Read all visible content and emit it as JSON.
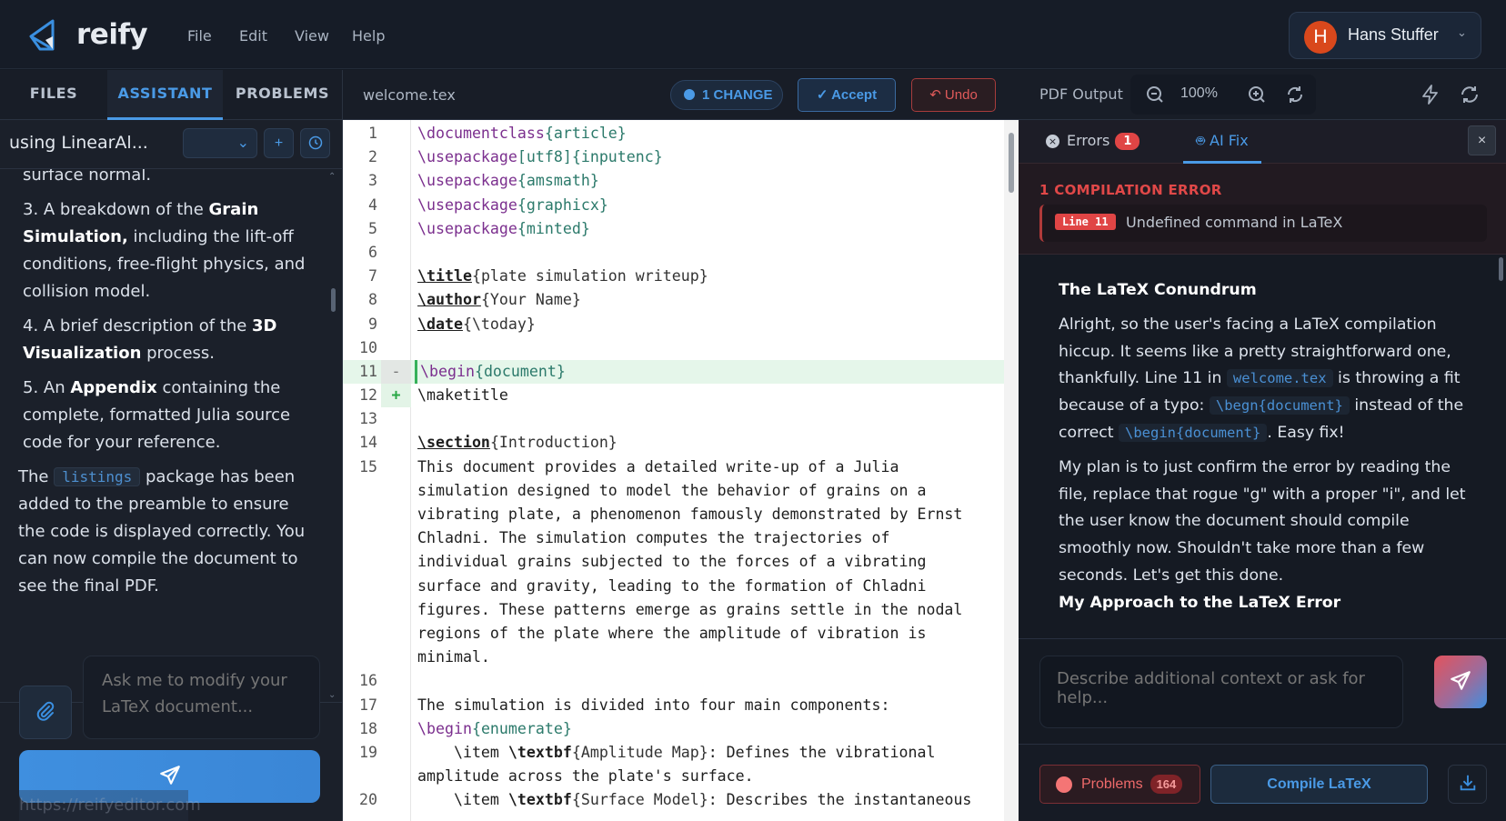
{
  "header": {
    "brand": "reify",
    "menu": [
      "File",
      "Edit",
      "View",
      "Help"
    ],
    "user": {
      "initial": "H",
      "name": "Hans Stuffer"
    }
  },
  "left": {
    "tabs": [
      "FILES",
      "ASSISTANT",
      "PROBLEMS"
    ],
    "active_tab": "ASSISTANT",
    "session_name": "using LinearAl...",
    "new_label": "+",
    "content": {
      "p0": "surface normal.",
      "item3": {
        "a": "3. A breakdown of the ",
        "b": "Grain Simulation,",
        "c": " including the lift-off conditions, free-flight physics, and collision model."
      },
      "item4": {
        "a": "4. A brief description of the ",
        "b": "3D Visualization",
        "c": " process."
      },
      "item5": {
        "a": "5. An ",
        "b": "Appendix",
        "c": " containing the complete, formatted Julia source code for your reference."
      },
      "para": {
        "a": "The ",
        "code": "listings",
        "c": " package has been added to the preamble to ensure the code is displayed correctly. You can now compile the document to see the final PDF."
      }
    },
    "input_placeholder": "Ask me to modify your LaTeX document...",
    "url_overlay": "https://reifyeditor.com"
  },
  "editor": {
    "filename": "welcome.tex",
    "changes": "1 CHANGE",
    "accept": "✓ Accept",
    "undo": "↶ Undo",
    "lines": [
      {
        "n": "1",
        "rows": [
          [
            [
              "cmd",
              "\\documentclass"
            ],
            [
              "arg",
              "{article}"
            ]
          ]
        ]
      },
      {
        "n": "2",
        "rows": [
          [
            [
              "cmd",
              "\\usepackage"
            ],
            [
              "arg",
              "[utf8]{inputenc}"
            ]
          ]
        ]
      },
      {
        "n": "3",
        "rows": [
          [
            [
              "cmd",
              "\\usepackage"
            ],
            [
              "arg",
              "{amsmath}"
            ]
          ]
        ]
      },
      {
        "n": "4",
        "rows": [
          [
            [
              "cmd",
              "\\usepackage"
            ],
            [
              "arg",
              "{graphicx}"
            ]
          ]
        ]
      },
      {
        "n": "5",
        "rows": [
          [
            [
              "cmd",
              "\\usepackage"
            ],
            [
              "arg",
              "{minted}"
            ]
          ]
        ]
      },
      {
        "n": "6",
        "rows": [
          []
        ]
      },
      {
        "n": "7",
        "rows": [
          [
            [
              "kw",
              "\\title"
            ],
            [
              "br",
              "{plate simulation writeup}"
            ]
          ]
        ]
      },
      {
        "n": "8",
        "rows": [
          [
            [
              "kw",
              "\\author"
            ],
            [
              "br",
              "{Your Name}"
            ]
          ]
        ]
      },
      {
        "n": "9",
        "rows": [
          [
            [
              "kw",
              "\\date"
            ],
            [
              "br",
              "{\\today}"
            ]
          ]
        ]
      },
      {
        "n": "10",
        "rows": [
          []
        ]
      },
      {
        "n": "11",
        "diff": "del",
        "mark": "-",
        "rows": [
          [
            [
              "cmd",
              "\\begin"
            ],
            [
              "arg",
              "{document}"
            ]
          ]
        ]
      },
      {
        "n": "12",
        "diff": "add",
        "mark": "+",
        "rows": [
          [
            [
              "plain",
              "\\maketitle"
            ]
          ]
        ]
      },
      {
        "n": "13",
        "rows": [
          []
        ]
      },
      {
        "n": "14",
        "rows": [
          [
            [
              "kw",
              "\\section"
            ],
            [
              "br",
              "{Introduction}"
            ]
          ]
        ]
      },
      {
        "n": "15",
        "rows": [
          [
            [
              "plain",
              "This document provides a detailed write-up of a Julia"
            ]
          ],
          [
            [
              "plain",
              "simulation designed to model the behavior of grains on a"
            ]
          ],
          [
            [
              "plain",
              "vibrating plate, a phenomenon famously demonstrated by Ernst"
            ]
          ],
          [
            [
              "plain",
              "Chladni. The simulation computes the trajectories of"
            ]
          ],
          [
            [
              "plain",
              "individual grains subjected to the forces of a vibrating"
            ]
          ],
          [
            [
              "plain",
              "surface and gravity, leading to the formation of Chladni"
            ]
          ],
          [
            [
              "plain",
              "figures. These patterns emerge as grains settle in the nodal"
            ]
          ],
          [
            [
              "plain",
              "regions of the plate where the amplitude of vibration is"
            ]
          ],
          [
            [
              "plain",
              "minimal."
            ]
          ]
        ]
      },
      {
        "n": "16",
        "rows": [
          []
        ]
      },
      {
        "n": "17",
        "rows": [
          [
            [
              "plain",
              "The simulation is divided into four main components:"
            ]
          ]
        ]
      },
      {
        "n": "18",
        "rows": [
          [
            [
              "cmd",
              "\\begin"
            ],
            [
              "arg",
              "{enumerate}"
            ]
          ]
        ]
      },
      {
        "n": "19",
        "rows": [
          [
            [
              "plain",
              "    \\item "
            ],
            [
              "b",
              "\\textbf"
            ],
            [
              "br",
              "{Amplitude Map}"
            ],
            [
              "plain",
              ": Defines the vibrational"
            ]
          ],
          [
            [
              "plain",
              "amplitude across the plate's surface."
            ]
          ]
        ]
      },
      {
        "n": "20",
        "rows": [
          [
            [
              "plain",
              "    \\item "
            ],
            [
              "b",
              "\\textbf"
            ],
            [
              "br",
              "{Surface Model}"
            ],
            [
              "plain",
              ": Describes the instantaneous"
            ]
          ]
        ]
      }
    ]
  },
  "right": {
    "title": "PDF Output",
    "zoom": "100%",
    "tabs": {
      "errors": "Errors",
      "errors_count": "1",
      "aifix": "AI Fix"
    },
    "close": "×",
    "error_title": "1 COMPILATION ERROR",
    "error": {
      "line": "Line 11",
      "message": "Undefined command in LaTeX"
    },
    "ai": {
      "heading": "The LaTeX Conundrum",
      "p1a": "Alright, so the user's facing a LaTeX compilation hiccup. It seems like a pretty straightforward one, thankfully. Line 11 in ",
      "p1code1": "welcome.tex",
      "p1b": " is throwing a fit because of a typo: ",
      "p1code2": "\\begn{document}",
      "p1c": " instead of the correct ",
      "p1code3": "\\begin{document}",
      "p1d": ". Easy fix!",
      "p2": "My plan is to just confirm the error by reading the file, replace that rogue \"g\" with a proper \"i\", and let the user know the document should compile smoothly now. Shouldn't take more than a few seconds. Let's get this done.",
      "heading2": "My Approach to the LaTeX Error"
    },
    "input_placeholder": "Describe additional context or ask for help...",
    "problems_label": "Problems",
    "problems_count": "164",
    "compile_label": "Compile LaTeX"
  },
  "colors": {
    "accent": "#4a9ae6",
    "error": "#e04545",
    "avatar": "#d9481c"
  }
}
